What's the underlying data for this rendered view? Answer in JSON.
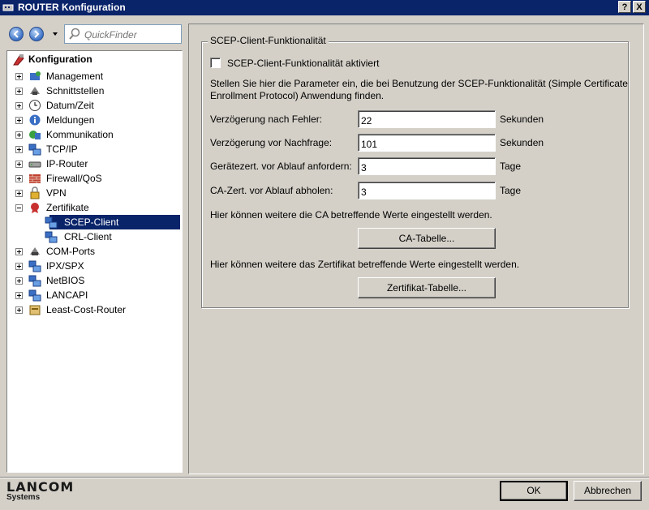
{
  "window": {
    "title": "ROUTER Konfiguration",
    "help_label": "?",
    "close_label": "X"
  },
  "nav": {
    "quickfinder_placeholder": "QuickFinder"
  },
  "tree": {
    "root": "Konfiguration",
    "items": [
      {
        "label": "Management",
        "icon": "management-icon"
      },
      {
        "label": "Schnittstellen",
        "icon": "interfaces-icon"
      },
      {
        "label": "Datum/Zeit",
        "icon": "clock-icon"
      },
      {
        "label": "Meldungen",
        "icon": "info-icon"
      },
      {
        "label": "Kommunikation",
        "icon": "communication-icon"
      },
      {
        "label": "TCP/IP",
        "icon": "network-icon"
      },
      {
        "label": "IP-Router",
        "icon": "router-icon"
      },
      {
        "label": "Firewall/QoS",
        "icon": "firewall-icon"
      },
      {
        "label": "VPN",
        "icon": "lock-icon"
      },
      {
        "label": "Zertifikate",
        "icon": "certificate-icon"
      },
      {
        "label": "SCEP-Client",
        "icon": "network-icon"
      },
      {
        "label": "CRL-Client",
        "icon": "network-icon"
      },
      {
        "label": "COM-Ports",
        "icon": "comport-icon"
      },
      {
        "label": "IPX/SPX",
        "icon": "network-icon"
      },
      {
        "label": "NetBIOS",
        "icon": "network-icon"
      },
      {
        "label": "LANCAPI",
        "icon": "network-icon"
      },
      {
        "label": "Least-Cost-Router",
        "icon": "lcr-icon"
      }
    ]
  },
  "main": {
    "group_title": "SCEP-Client-Funktionalität",
    "checkbox_label": "SCEP-Client-Funktionalität aktiviert",
    "checkbox_checked": false,
    "description_line1": "Stellen Sie hier die Parameter ein, die bei Benutzung der SCEP-Funktionalität (Simple Certificate",
    "description_line2": "Enrollment Protocol) Anwendung finden.",
    "fields": [
      {
        "label": "Verzögerung nach Fehler:",
        "value": "22",
        "unit": "Sekunden"
      },
      {
        "label": "Verzögerung vor Nachfrage:",
        "value": "101",
        "unit": "Sekunden"
      },
      {
        "label": "Gerätezert. vor Ablauf anfordern:",
        "value": "3",
        "unit": "Tage"
      },
      {
        "label": "CA-Zert. vor Ablauf abholen:",
        "value": "3",
        "unit": "Tage"
      }
    ],
    "ca_text": "Hier können weitere die CA betreffende Werte eingestellt werden.",
    "ca_button": "CA-Tabelle...",
    "cert_text": "Hier können weitere das Zertifikat betreffende Werte eingestellt werden.",
    "cert_button": "Zertifikat-Tabelle..."
  },
  "footer": {
    "logo_line1": "LANCOM",
    "logo_line2": "Systems",
    "ok": "OK",
    "cancel": "Abbrechen"
  },
  "colors": {
    "titlebar": "#0a246a",
    "selection": "#0a246a",
    "dialog": "#d4d0c8"
  }
}
